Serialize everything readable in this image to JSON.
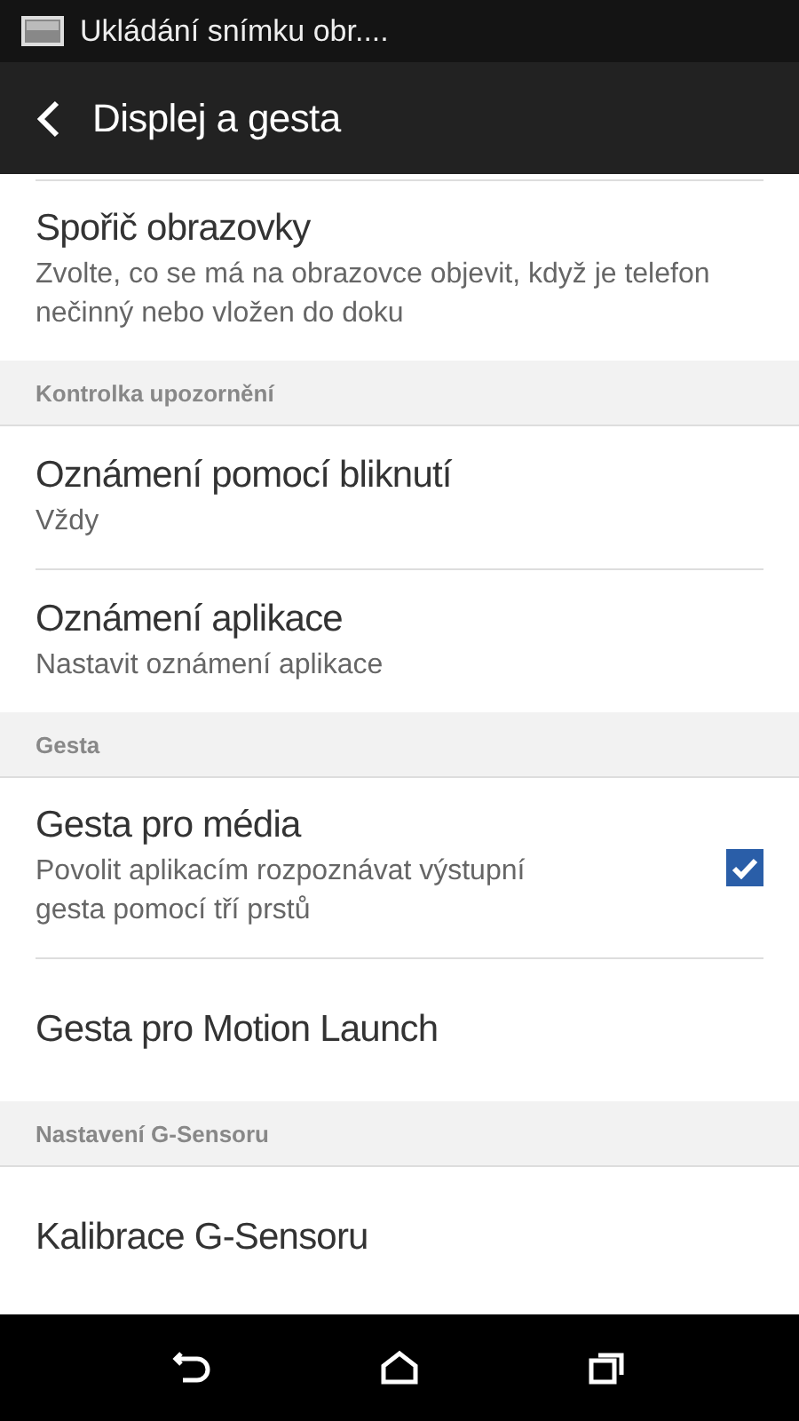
{
  "status_bar": {
    "notification_text": "Ukládání snímku obr...."
  },
  "app_bar": {
    "title": "Displej a gesta"
  },
  "items": [
    {
      "kind": "setting",
      "title": "Spořič obrazovky",
      "summary": "Zvolte, co se má na obrazovce objevit, když je telefon nečinný nebo vložen do doku"
    },
    {
      "kind": "section",
      "title": "Kontrolka upozornění"
    },
    {
      "kind": "setting",
      "title": "Oznámení pomocí bliknutí",
      "summary": "Vždy"
    },
    {
      "kind": "setting",
      "title": "Oznámení aplikace",
      "summary": "Nastavit oznámení aplikace"
    },
    {
      "kind": "section",
      "title": "Gesta"
    },
    {
      "kind": "checkbox",
      "title": "Gesta pro média",
      "summary": "Povolit aplikacím rozpoznávat výstupní gesta pomocí tří prstů",
      "checked": true
    },
    {
      "kind": "setting",
      "title": "Gesta pro Motion Launch"
    },
    {
      "kind": "section",
      "title": "Nastavení G-Sensoru"
    },
    {
      "kind": "setting",
      "title": "Kalibrace G-Sensoru"
    }
  ]
}
